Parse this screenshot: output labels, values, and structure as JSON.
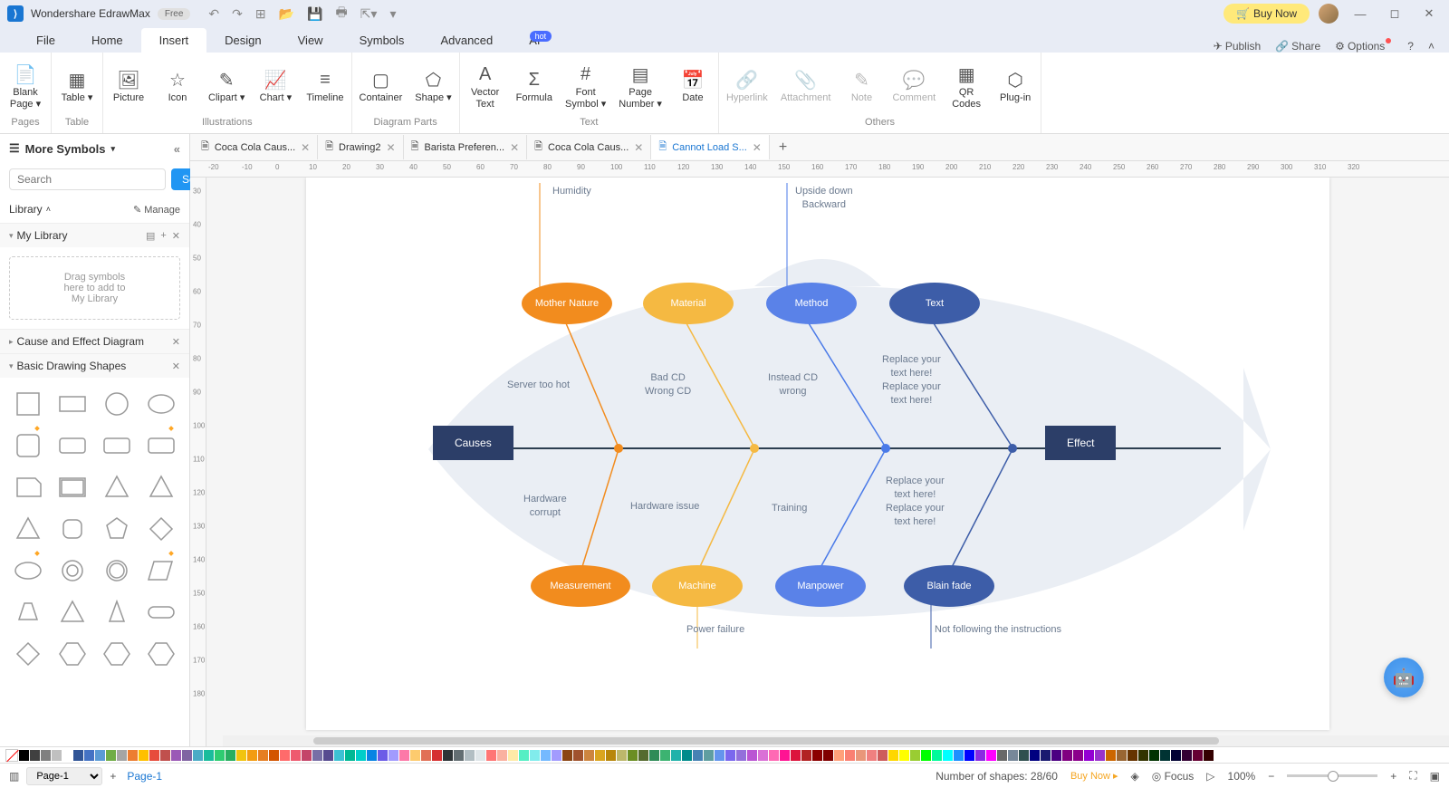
{
  "app": {
    "title": "Wondershare EdrawMax",
    "badge": "Free"
  },
  "titlebar": {
    "buy": "Buy Now"
  },
  "menu": {
    "tabs": [
      "File",
      "Home",
      "Insert",
      "Design",
      "View",
      "Symbols",
      "Advanced",
      "AI"
    ],
    "active": 2,
    "right": {
      "publish": "Publish",
      "share": "Share",
      "options": "Options"
    }
  },
  "ribbon": {
    "groups": [
      {
        "label": "Pages",
        "items": [
          {
            "icon": "📄",
            "label": "Blank\nPage ▾"
          }
        ]
      },
      {
        "label": "Table",
        "items": [
          {
            "icon": "▦",
            "label": "Table ▾"
          }
        ]
      },
      {
        "label": "Illustrations",
        "items": [
          {
            "icon": "🖼",
            "label": "Picture"
          },
          {
            "icon": "☆",
            "label": "Icon"
          },
          {
            "icon": "✎",
            "label": "Clipart ▾"
          },
          {
            "icon": "📈",
            "label": "Chart ▾"
          },
          {
            "icon": "≡",
            "label": "Timeline"
          }
        ]
      },
      {
        "label": "Diagram Parts",
        "items": [
          {
            "icon": "▢",
            "label": "Container"
          },
          {
            "icon": "⬠",
            "label": "Shape ▾"
          }
        ]
      },
      {
        "label": "Text",
        "items": [
          {
            "icon": "A",
            "label": "Vector\nText"
          },
          {
            "icon": "Σ",
            "label": "Formula"
          },
          {
            "icon": "#",
            "label": "Font\nSymbol ▾"
          },
          {
            "icon": "▤",
            "label": "Page\nNumber ▾"
          },
          {
            "icon": "📅",
            "label": "Date"
          }
        ]
      },
      {
        "label": "Others",
        "items": [
          {
            "icon": "🔗",
            "label": "Hyperlink",
            "dis": true
          },
          {
            "icon": "📎",
            "label": "Attachment",
            "dis": true
          },
          {
            "icon": "✎",
            "label": "Note",
            "dis": true
          },
          {
            "icon": "💬",
            "label": "Comment",
            "dis": true
          },
          {
            "icon": "▦",
            "label": "QR\nCodes"
          },
          {
            "icon": "⬡",
            "label": "Plug-in"
          }
        ]
      }
    ]
  },
  "sidebar": {
    "header": "More Symbols",
    "search": {
      "placeholder": "Search",
      "button": "Search"
    },
    "library": "Library",
    "manage": "Manage",
    "sections": [
      {
        "title": "My Library",
        "drop": "Drag symbols\nhere to add to\nMy Library"
      },
      {
        "title": "Cause and Effect Diagram"
      },
      {
        "title": "Basic Drawing Shapes"
      }
    ]
  },
  "docTabs": [
    {
      "label": "Coca Cola Caus..."
    },
    {
      "label": "Drawing2"
    },
    {
      "label": "Barista Preferen..."
    },
    {
      "label": "Coca Cola Caus..."
    },
    {
      "label": "Cannot Load S...",
      "active": true
    }
  ],
  "diagram": {
    "causes_label": "Causes",
    "effect_label": "Effect",
    "top_cats": [
      {
        "t": "Mother\nNature",
        "c": "#f28c1e"
      },
      {
        "t": "Material",
        "c": "#f5b942"
      },
      {
        "t": "Method",
        "c": "#4a7ae8"
      },
      {
        "t": "Text",
        "c": "#3d5da8"
      }
    ],
    "bot_cats": [
      {
        "t": "Measurement",
        "c": "#f28c1e"
      },
      {
        "t": "Machine",
        "c": "#f5b942"
      },
      {
        "t": "Manpower",
        "c": "#4a7ae8"
      },
      {
        "t": "Blain fade",
        "c": "#3d5da8"
      }
    ],
    "node_colors": [
      "#f28c1e",
      "#f5b942",
      "#4a7ae8",
      "#3d5da8"
    ],
    "labels": {
      "humidity": "Humidity",
      "upside": "Upside down\nBackward",
      "server": "Server too hot",
      "badcd": "Bad CD\nWrong CD",
      "instead": "Instead CD\nwrong",
      "replace1": "Replace your\ntext here!\nReplace your\ntext here!",
      "hwcorrupt": "Hardware\ncorrupt",
      "hwissue": "Hardware issue",
      "training": "Training",
      "replace2": "Replace your\ntext here!\nReplace your\ntext here!",
      "power": "Power failure",
      "notfollow": "Not following the instructions"
    }
  },
  "status": {
    "page": "Page-1",
    "page_tab": "Page-1",
    "shapes": "Number of shapes: 28/60",
    "buy": "Buy Now",
    "focus": "Focus",
    "zoom": "100%"
  }
}
